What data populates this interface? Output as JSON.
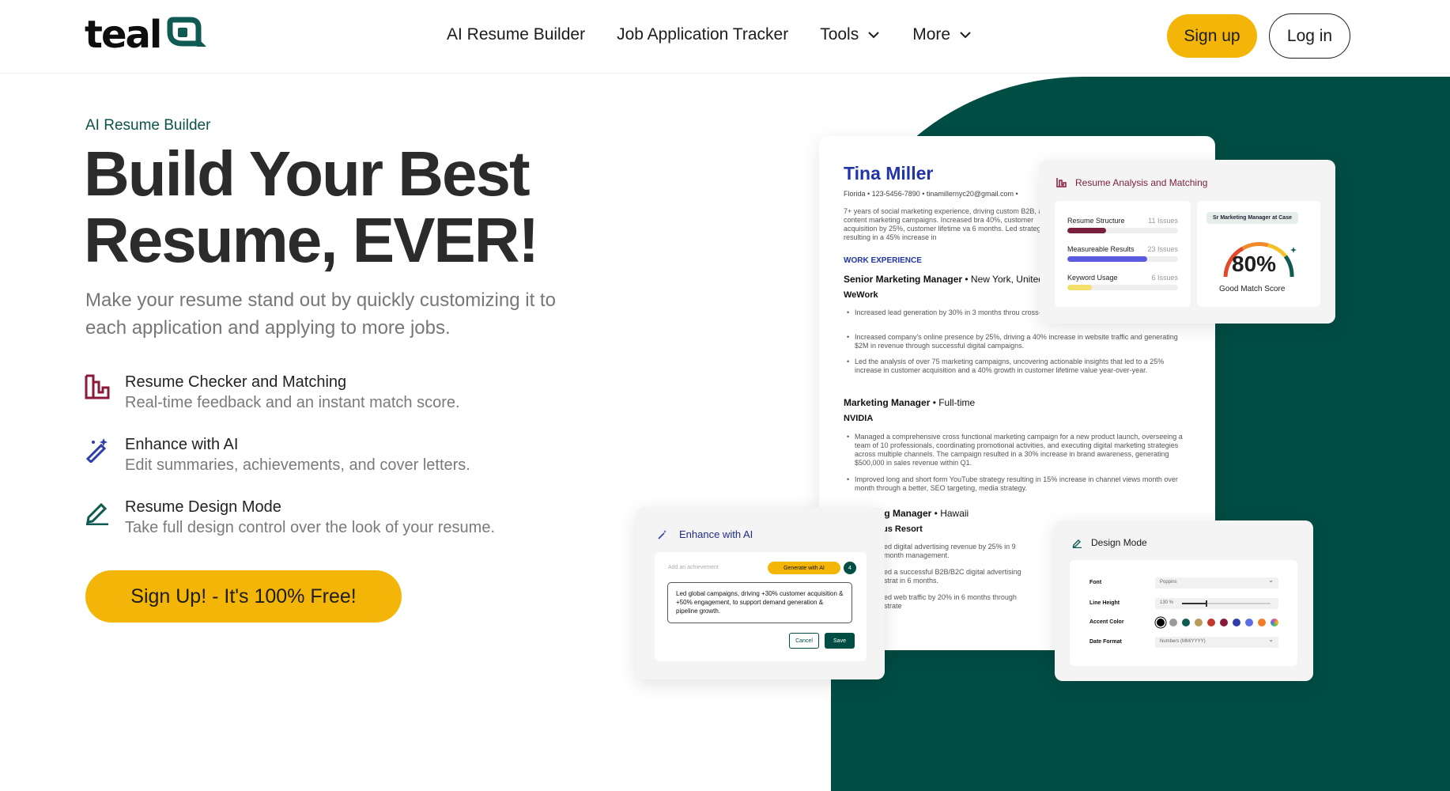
{
  "nav": {
    "logo_text": "teal",
    "links": [
      {
        "label": "AI Resume Builder"
      },
      {
        "label": "Job Application Tracker"
      },
      {
        "label": "Tools"
      },
      {
        "label": "More"
      }
    ],
    "signup_label": "Sign up",
    "login_label": "Log in"
  },
  "hero": {
    "eyebrow": "AI Resume Builder",
    "headline": "Build Your Best Resume, EVER!",
    "subhead": "Make your resume stand out by quickly customizing it to each application and applying to more jobs.",
    "features": [
      {
        "title": "Resume Checker and Matching",
        "desc": "Real-time feedback and an instant match score.",
        "icon": "bar-chart-icon"
      },
      {
        "title": "Enhance with AI",
        "desc": "Edit summaries, achievements, and cover letters.",
        "icon": "magic-wand-icon"
      },
      {
        "title": "Resume Design Mode",
        "desc": "Take full design control over the look of your resume.",
        "icon": "pencil-icon"
      }
    ],
    "cta_label": "Sign Up! - It's 100% Free!"
  },
  "resume": {
    "name": "Tina Miller",
    "contact": "Florida • 123-5456-7890 • tinamillernyc20@gmail.com •",
    "summary": "7+ years of social marketing experience, driving custom B2B, and content marketing campaigns. Increased bra 40%, customer acquisition by 25%, customer lifetime va 6 months. Led strategies, resulting in a 45% increase in",
    "section_title": "WORK EXPERIENCE",
    "jobs": [
      {
        "title": "Senior Marketing Manager",
        "meta": " • New York, United",
        "company": "WeWork",
        "bullets": [
          "Increased lead generation by 30% in 3 months throu cross-channel campaigns targeting key customer se",
          "Increased company's online presence by 25%, driving a 40% increase in website traffic and generating $2M in revenue through successful digital campaigns.",
          "Led the analysis of over 75 marketing campaigns, uncovering actionable insights that led to a 25% increase in customer acquisition and a 40% growth in customer lifetime value year-over-year."
        ]
      },
      {
        "title": "Marketing Manager",
        "meta": " • Full-time",
        "company": "NVIDIA",
        "bullets": [
          "Managed a comprehensive cross functional marketing campaign for a new product launch, overseeing a team of 10 professionals, coordinating promotional activities, and executing digital marketing strategies across multiple channels. The campaign resulted in a 30% increase in brand awareness, generating $500,000 in sales revenue within Q1.",
          "Improved long and short form YouTube strategy resulting in 15% increase in channel views month over month through a better, SEO targeting, media strategy."
        ]
      },
      {
        "title": "ng Manager",
        "meta": " • Hawaii",
        "company": "us Resort",
        "bullets": [
          "ed digital advertising revenue by 25% in 9 month management.",
          "ed a successful B2B/B2C digital advertising strat in 6 months.",
          "ed web traffic by 20% in 6 months through strate"
        ]
      }
    ]
  },
  "analysis": {
    "title": "Resume Analysis and Matching",
    "metrics": [
      {
        "label": "Resume Structure",
        "issues": "11 Issues",
        "fill": 0.35,
        "color": "#7a1f3d"
      },
      {
        "label": "Measureable Results",
        "issues": "23 Issues",
        "fill": 0.72,
        "color": "#5b5be0"
      },
      {
        "label": "Keyword Usage",
        "issues": "6 Issues",
        "fill": 0.22,
        "color": "#f3e06a"
      }
    ],
    "role": "Sr Marketing Manager at Case",
    "score": "80%",
    "score_label": "Good Match Score"
  },
  "enhance": {
    "title": "Enhance with AI",
    "placeholder": "Add an achievement",
    "generate_label": "Generate with AI",
    "count": "4",
    "text": "Led global campaigns, driving +30% customer acquisition & +50% engagement, to support demand generation & pipeline growth.",
    "cancel_label": "Cancel",
    "save_label": "Save"
  },
  "design": {
    "title": "Design Mode",
    "font_label": "Font",
    "font_value": "Poppins",
    "line_height_label": "Line Height",
    "line_height_value": "130 %",
    "accent_label": "Accent Color",
    "accent_colors": [
      "#000000",
      "#9a9a9a",
      "#0f5a52",
      "#b89a5a",
      "#c0392b",
      "#8b1a3a",
      "#2f3ea8",
      "#5b6fe0",
      "#ef7d2a",
      "#e05a9a"
    ],
    "date_label": "Date Format",
    "date_value": "Numbers (MM/YYYY)"
  }
}
